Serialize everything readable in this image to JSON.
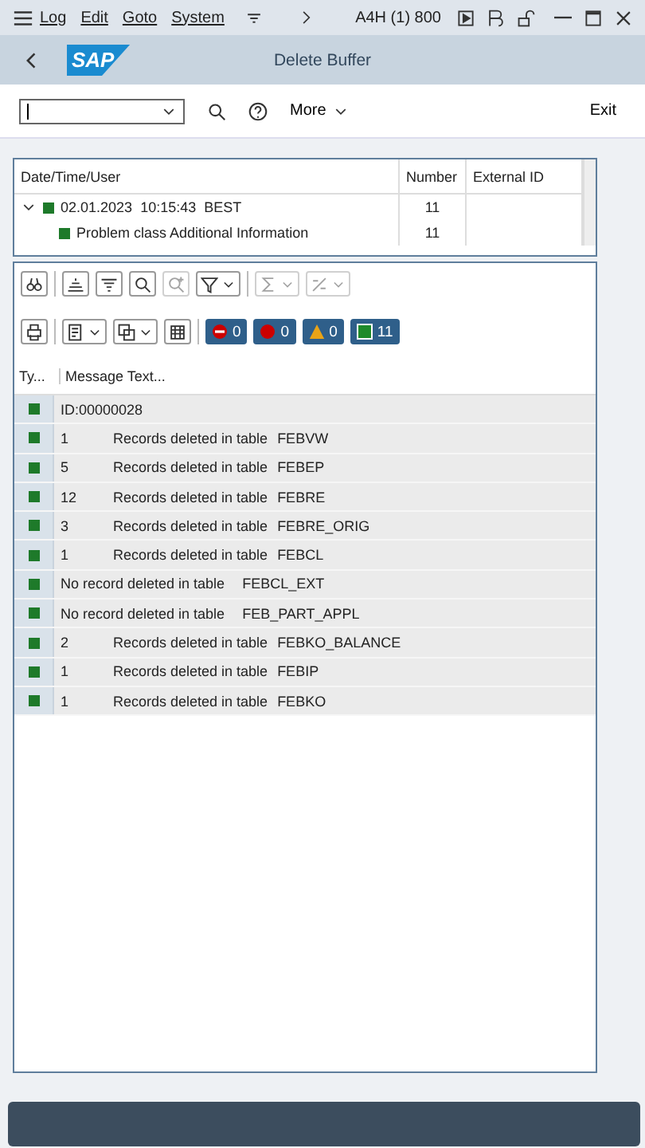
{
  "menu_bar": {
    "items": [
      "Log",
      "Edit",
      "Goto",
      "System"
    ],
    "system": "A4H (1) 800"
  },
  "header": {
    "logo": "SAP",
    "title": "Delete Buffer"
  },
  "toolbar": {
    "more": "More",
    "exit": "Exit"
  },
  "log_tree": {
    "columns": [
      "Date/Time/User",
      "Number",
      "External ID"
    ],
    "rows": [
      {
        "date": "02.01.2023",
        "time": "10:15:43",
        "user": "BEST",
        "number": "11",
        "expanded": true,
        "children": [
          {
            "label": "Problem class Additional Information",
            "number": "11"
          }
        ]
      }
    ]
  },
  "counters": [
    {
      "kind": "stop",
      "count": "0"
    },
    {
      "kind": "error",
      "count": "0"
    },
    {
      "kind": "warning",
      "count": "0"
    },
    {
      "kind": "success",
      "count": "11"
    }
  ],
  "messages": {
    "columns": [
      "Ty...",
      "Message Text..."
    ],
    "rows": [
      {
        "text": "ID:00000028"
      },
      {
        "count": "1",
        "text": "Records deleted in table",
        "table": "FEBVW"
      },
      {
        "count": "5",
        "text": "Records deleted in table",
        "table": "FEBEP"
      },
      {
        "count": "12",
        "text": "Records deleted in table",
        "table": "FEBRE"
      },
      {
        "count": "3",
        "text": "Records deleted in table",
        "table": "FEBRE_ORIG"
      },
      {
        "count": "1",
        "text": "Records deleted in table",
        "table": "FEBCL"
      },
      {
        "text": "No record deleted in table",
        "table": "FEBCL_EXT"
      },
      {
        "text": "No record deleted in table",
        "table": "FEB_PART_APPL"
      },
      {
        "count": "2",
        "text": "Records deleted in table",
        "table": "FEBKO_BALANCE"
      },
      {
        "count": "1",
        "text": "Records deleted in table",
        "table": "FEBIP"
      },
      {
        "count": "1",
        "text": "Records deleted in table",
        "table": "FEBKO"
      }
    ]
  }
}
